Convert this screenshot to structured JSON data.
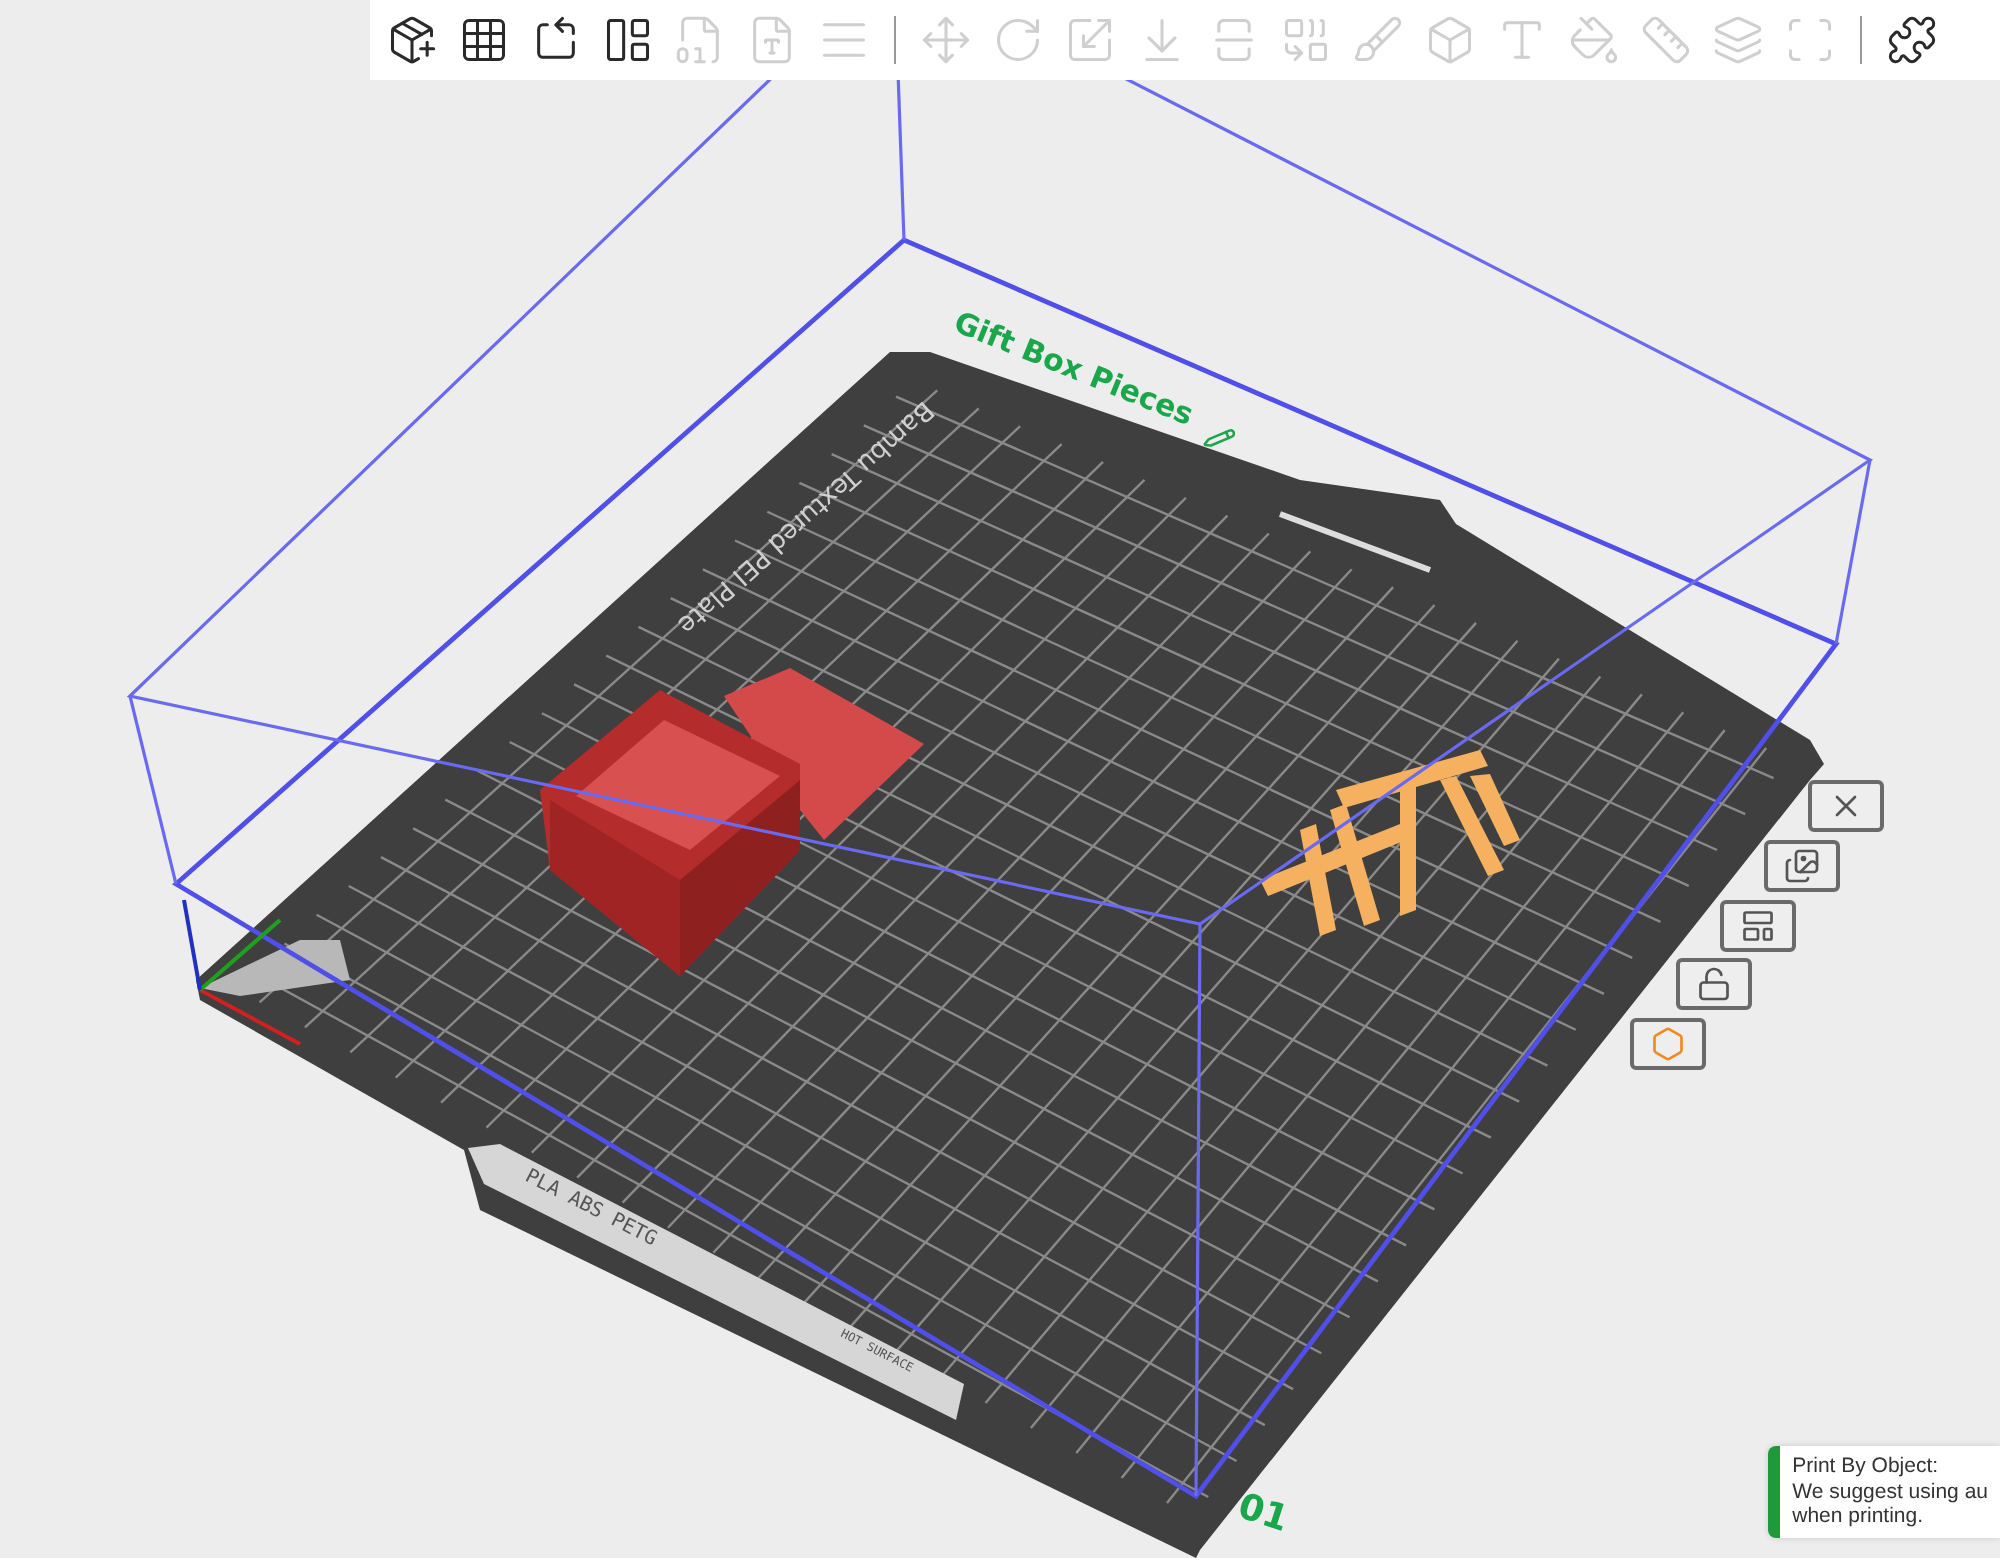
{
  "toolbar": {
    "groups": [
      {
        "tools": [
          {
            "disabled": false
          },
          {
            "disabled": false
          },
          {
            "disabled": false
          },
          {
            "disabled": false
          },
          {
            "disabled": true
          },
          {
            "disabled": true
          },
          {
            "disabled": true
          }
        ]
      },
      {
        "tools": [
          {
            "disabled": true
          },
          {
            "disabled": true
          },
          {
            "disabled": true
          },
          {
            "disabled": true
          },
          {
            "disabled": true
          },
          {
            "disabled": true
          },
          {
            "disabled": true
          },
          {
            "disabled": true
          },
          {
            "disabled": true
          },
          {
            "disabled": true
          },
          {
            "disabled": true
          },
          {
            "disabled": true
          },
          {
            "disabled": true
          }
        ]
      },
      {
        "tools": [
          {
            "disabled": false
          }
        ]
      }
    ]
  },
  "plate": {
    "name": "Gift Box Pieces",
    "index": "01",
    "surface_label": "Bambu Textured PEI Plate",
    "filament_label": "PLA ABS PETG",
    "warning_label": "HOT SURFACE",
    "buttons": [
      {
        "highlighted": false
      },
      {
        "highlighted": false
      },
      {
        "highlighted": false
      },
      {
        "highlighted": false
      },
      {
        "highlighted": true
      }
    ]
  },
  "notification": {
    "title": "Print By Object:",
    "lines": [
      "We suggest using au",
      "when printing."
    ]
  }
}
